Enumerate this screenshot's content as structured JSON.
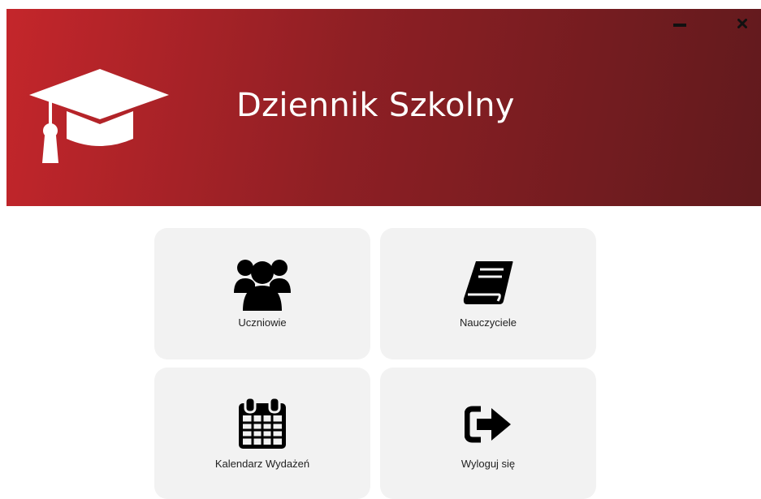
{
  "header": {
    "title": "Dziennik Szkolny",
    "logo_icon": "graduation-cap-icon",
    "minimize_icon": "minimize-icon",
    "close_icon": "close-icon",
    "gradient_start": "#c4262b",
    "gradient_end": "#611a1d"
  },
  "tiles": [
    {
      "label": "Uczniowie",
      "icon": "users-icon"
    },
    {
      "label": "Nauczyciele",
      "icon": "book-icon"
    },
    {
      "label": "Kalendarz Wydażeń",
      "icon": "calendar-icon"
    },
    {
      "label": "Wyloguj się",
      "icon": "sign-out-icon"
    }
  ],
  "colors": {
    "tile_background": "#f2f2f2",
    "icon_color": "#000000",
    "page_background": "#ffffff"
  }
}
